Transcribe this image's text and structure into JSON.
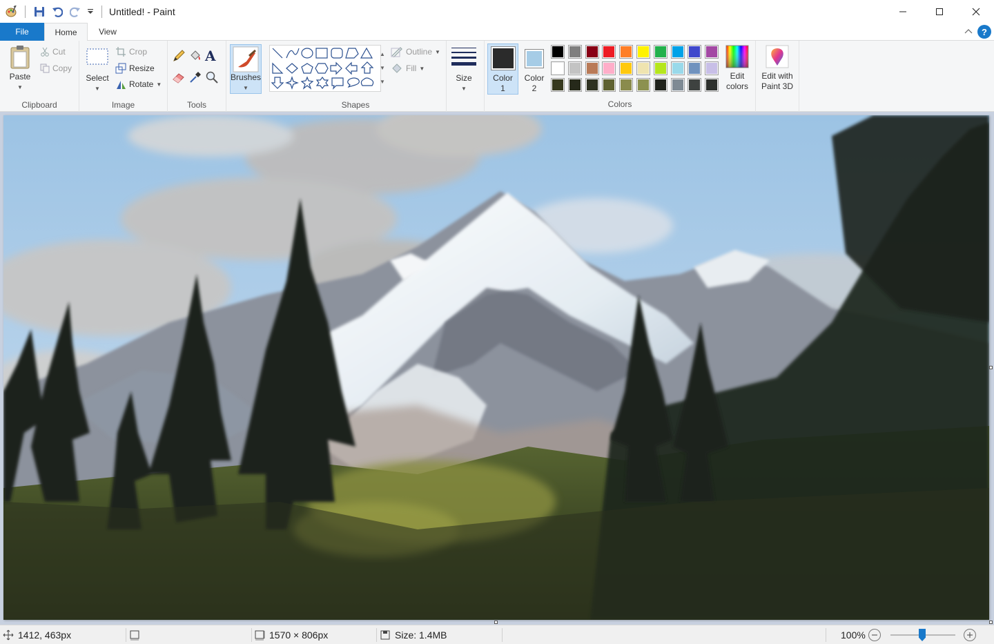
{
  "window": {
    "title": "Untitled! - Paint"
  },
  "tabs": {
    "file": "File",
    "home": "Home",
    "view": "View"
  },
  "clipboard": {
    "label": "Clipboard",
    "paste": "Paste",
    "cut": "Cut",
    "copy": "Copy"
  },
  "image": {
    "label": "Image",
    "select": "Select",
    "crop": "Crop",
    "resize": "Resize",
    "rotate": "Rotate"
  },
  "tools": {
    "label": "Tools",
    "text_tool_glyph": "A"
  },
  "brushes": {
    "label": "Brushes"
  },
  "shapes": {
    "label": "Shapes",
    "outline": "Outline",
    "fill": "Fill"
  },
  "size": {
    "label": "Size"
  },
  "colors": {
    "label": "Colors",
    "color1_line1": "Color",
    "color1_line2": "1",
    "color2_line1": "Color",
    "color2_line2": "2",
    "edit_colors_line1": "Edit",
    "edit_colors_line2": "colors",
    "color1_value": "#2b2b2b",
    "color2_value": "#a6cce6",
    "palette_row1": [
      "#000000",
      "#7f7f7f",
      "#880015",
      "#ed1c24",
      "#ff7f27",
      "#fff200",
      "#22b14c",
      "#00a2e8",
      "#3f48cc",
      "#a349a4"
    ],
    "palette_row2": [
      "#ffffff",
      "#c3c3c3",
      "#b97a57",
      "#ffaec9",
      "#ffc90e",
      "#efe4b0",
      "#b5e61d",
      "#99d9ea",
      "#7092be",
      "#c8bfe7"
    ],
    "palette_row3": [
      "#37391f",
      "#26291a",
      "#2e3121",
      "#5f6131",
      "#8a8b4d",
      "#8c9150",
      "#1f221b",
      "#7e8a94",
      "#3e4240",
      "#2d302d"
    ]
  },
  "paint3d": {
    "line1": "Edit with",
    "line2": "Paint 3D"
  },
  "status": {
    "cursor_pos": "1412, 463px",
    "image_size": "1570 × 806px",
    "file_size": "Size: 1.4MB",
    "zoom": "100%"
  }
}
